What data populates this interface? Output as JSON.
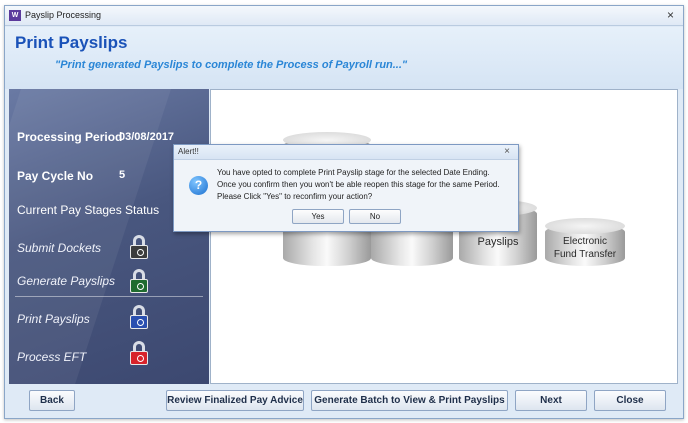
{
  "window": {
    "app_icon": "W",
    "title": "Payslip Processing",
    "close_label": "×"
  },
  "header": {
    "title": "Print Payslips",
    "subtitle": "\"Print generated Payslips to complete the Process of Payroll run...\""
  },
  "sidebar": {
    "period_label": "Processing Period",
    "period_value": "03/08/2017",
    "cycle_label": "Pay Cycle No",
    "cycle_value": "5",
    "status_heading": "Current Pay Stages Status",
    "stages": [
      {
        "label": "Submit Dockets",
        "lock_color": "#3c3c3c",
        "icon": "padlock-open-icon"
      },
      {
        "label": "Generate Payslips",
        "lock_color": "#1f6b2f",
        "icon": "padlock-open-icon"
      },
      {
        "label": "Print Payslips",
        "lock_color": "#2a4fb0",
        "icon": "padlock-open-icon"
      },
      {
        "label": "Process EFT",
        "lock_color": "#d8232a",
        "icon": "padlock-open-icon"
      }
    ]
  },
  "diagram": {
    "payslips_label": "Payslips",
    "eft_label_line1": "Electronic",
    "eft_label_line2": "Fund Transfer"
  },
  "dialog": {
    "title": "Alert!!",
    "close_label": "×",
    "icon": "question-icon",
    "icon_glyph": "?",
    "line1": "You have opted to complete Print Payslip stage for the selected Date Ending.",
    "line2": "Once you confirm then you won't be able reopen this stage for the same Period.",
    "line3": "Please Click \"Yes\" to reconfirm your action?",
    "yes_label": "Yes",
    "no_label": "No"
  },
  "footer": {
    "back_label": "Back",
    "review_label": "Review Finalized Pay Advice",
    "generate_label": "Generate Batch to View & Print Payslips",
    "next_label": "Next",
    "close_label": "Close"
  }
}
